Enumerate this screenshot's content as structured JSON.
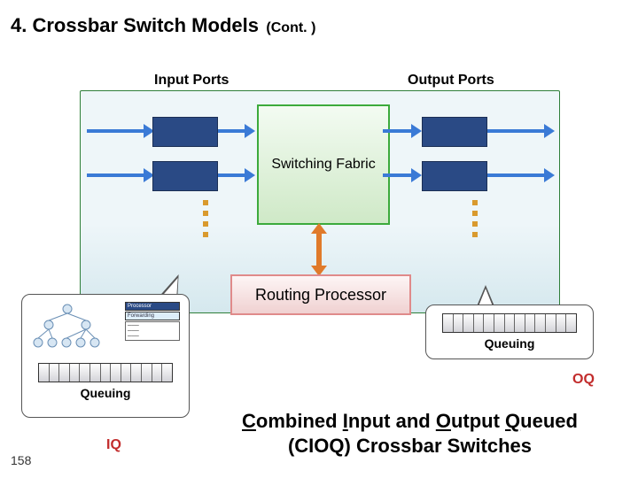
{
  "slide": {
    "number": "158",
    "title_main": "4. Crossbar Switch Models",
    "title_cont": "(Cont. )"
  },
  "labels": {
    "input_ports": "Input Ports",
    "output_ports": "Output Ports",
    "switching_fabric": "Switching Fabric",
    "routing_processor": "Routing Processor",
    "queuing": "Queuing",
    "oq": "OQ",
    "iq": "IQ"
  },
  "cioq": {
    "line1_prefix": "C",
    "line1_mid": "ombined ",
    "line1_u2": "I",
    "line1_mid2": "nput  and ",
    "line1_u3": "O",
    "line1_mid3": "utput ",
    "line1_u4": "Q",
    "line1_suffix": "ueued",
    "line2": "(CIOQ) Crossbar Switches"
  }
}
